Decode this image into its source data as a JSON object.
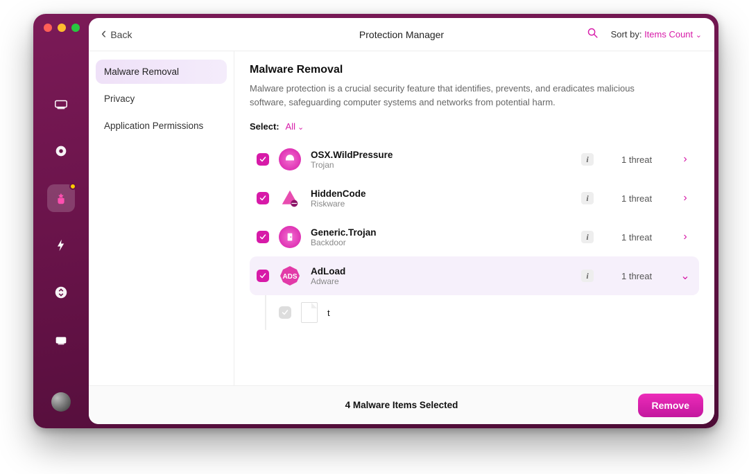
{
  "topbar": {
    "back_label": "Back",
    "title": "Protection Manager",
    "sort_label": "Sort by:",
    "sort_value": "Items Count"
  },
  "sidebar": {
    "items": [
      {
        "label": "Malware Removal",
        "active": true
      },
      {
        "label": "Privacy",
        "active": false
      },
      {
        "label": "Application Permissions",
        "active": false
      }
    ]
  },
  "main": {
    "heading": "Malware Removal",
    "description": "Malware protection is a crucial security feature that identifies, prevents, and eradicates malicious software, safeguarding computer systems and networks from potential harm.",
    "select_label": "Select:",
    "select_value": "All",
    "threats": [
      {
        "name": "OSX.WildPressure",
        "type": "Trojan",
        "count": "1 threat",
        "checked": true,
        "expanded": false,
        "icon": "shell"
      },
      {
        "name": "HiddenCode",
        "type": "Riskware",
        "count": "1 threat",
        "checked": true,
        "expanded": false,
        "icon": "alert-bug"
      },
      {
        "name": "Generic.Trojan",
        "type": "Backdoor",
        "count": "1 threat",
        "checked": true,
        "expanded": false,
        "icon": "door"
      },
      {
        "name": "AdLoad",
        "type": "Adware",
        "count": "1 threat",
        "checked": true,
        "expanded": true,
        "icon": "ads",
        "children": [
          {
            "name": "t",
            "checked": true
          }
        ]
      }
    ]
  },
  "footer": {
    "message": "4 Malware Items Selected",
    "remove_label": "Remove"
  }
}
